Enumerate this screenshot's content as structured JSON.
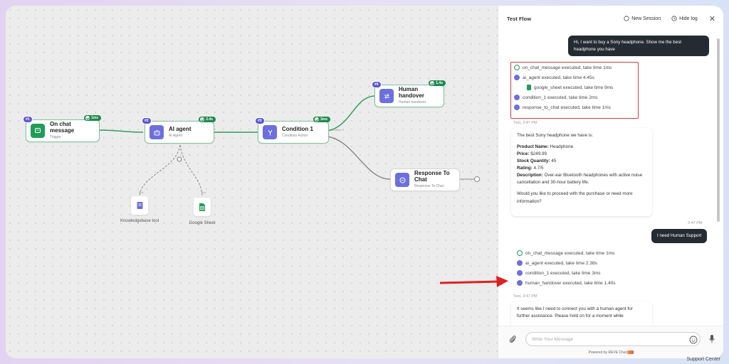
{
  "canvas": {
    "nodes": [
      {
        "num": "#1",
        "title": "On chat message",
        "sub": "Trigger",
        "time": "1ms"
      },
      {
        "num": "#2",
        "title": "AI agent",
        "sub": "AI Agent",
        "time": "2.4s"
      },
      {
        "num": "#3",
        "title": "Condition 1",
        "sub": "Condition Action",
        "time": "3ms"
      },
      {
        "num": "#4",
        "title": "Human handover",
        "sub": "Human handover",
        "time": "1.4s"
      },
      {
        "num": "",
        "title": "Response To Chat",
        "sub": "Response To Chat",
        "time": ""
      }
    ],
    "tools": [
      {
        "label": "Knowledgebase tool",
        "tag": "Tool"
      },
      {
        "label": "Google Sheet",
        "tag": "Tool"
      }
    ],
    "edge_label": "Condition 1"
  },
  "panel": {
    "title": "Test Flow",
    "new_session": "New Session",
    "hide_log": "Hide log",
    "input_placeholder": "Write Your Message",
    "powered_by": "Powered by REVE Chat",
    "messages": {
      "user1": "Hi, I want to buy a Sony headphone. Show me the best headphone you have",
      "log1": [
        "on_chat_message executed, take time 1ms",
        "ai_agent executed, take time 4.45s",
        "google_sheet executed, take time 9ms",
        "condition_1 executed, take time 2ms",
        "response_to_chat executed, take time 1ms"
      ],
      "bot1_time": "Test, 3:47 PM",
      "bot1": {
        "intro": "The best Sony headphone we have is:",
        "name_label": "Product Name:",
        "name": "Headphone",
        "price_label": "Price:",
        "price": "$249.99",
        "stock_label": "Stock Quantity:",
        "stock": "45",
        "rating_label": "Rating:",
        "rating": "4.7/5",
        "desc_label": "Description:",
        "desc": "Over-ear Bluetooth headphones with active noise cancellation and 30-hour battery life.",
        "outro": "Would you like to proceed with the purchase or need more information?"
      },
      "user2_time": "3:47 PM",
      "user2": "I need Human Support",
      "log2": [
        "on_chat_message executed, take time 1ms",
        "ai_agent executed, take time 2.38s",
        "condition_1 executed, take time 3ms",
        "human_handover executed, take time 1.40s"
      ],
      "bot2_time": "Test, 3:47 PM",
      "bot2": "It seems like I need to connect you with a human agent for further assistance. Please hold on for a moment while"
    }
  },
  "support_center": "Support Center",
  "colors": {
    "accent": "#6d6fe0",
    "success": "#1f9d58",
    "highlight": "#d33c3c",
    "dark_bubble": "#252b33"
  }
}
